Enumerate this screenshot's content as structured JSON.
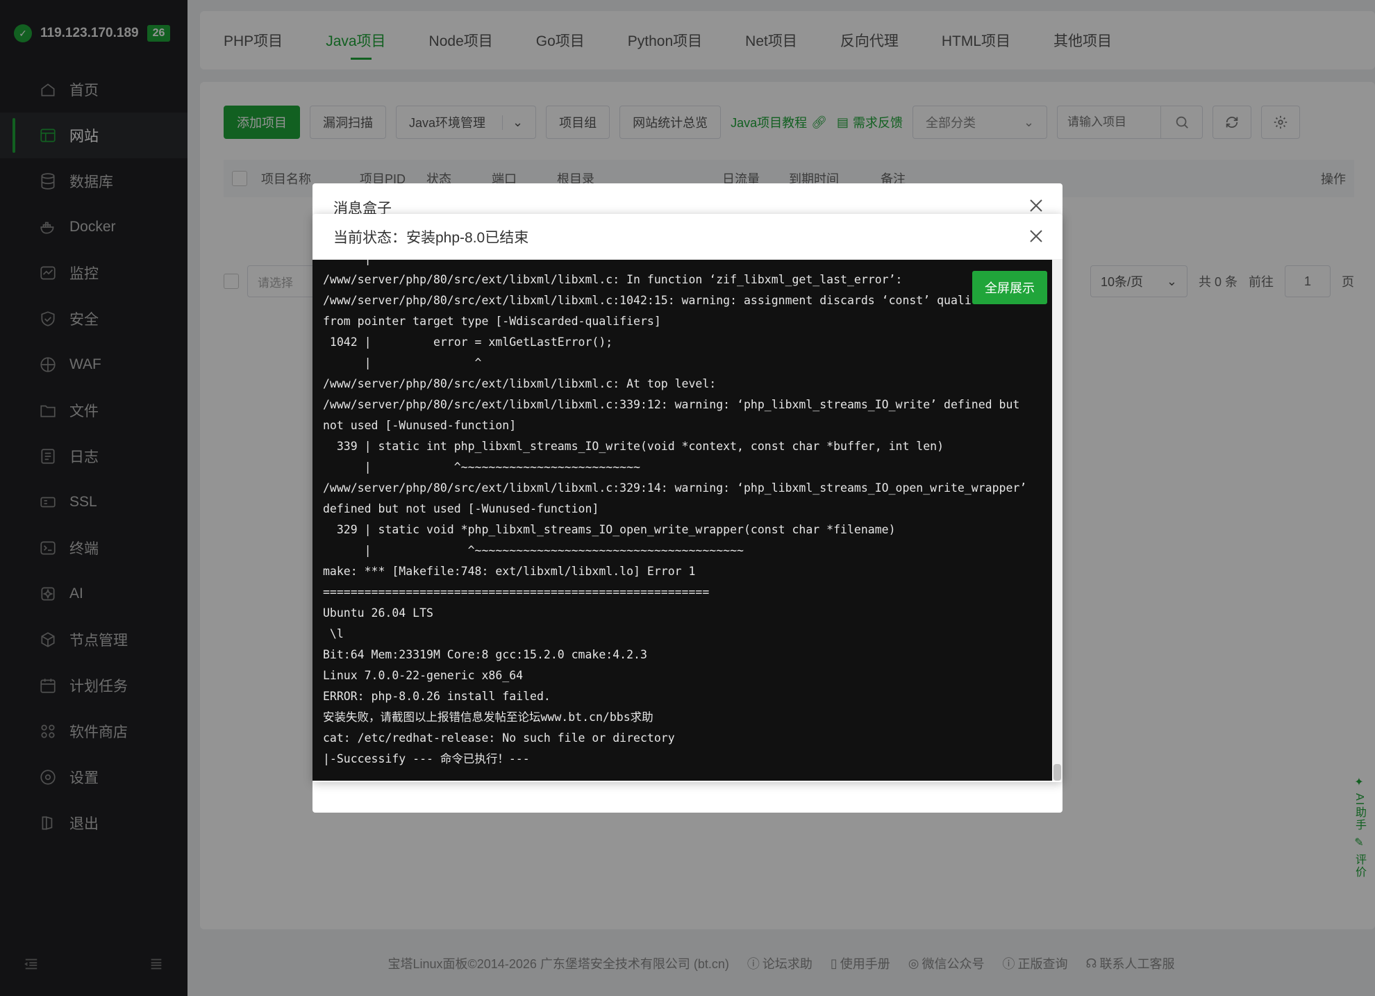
{
  "server": {
    "ip": "119.123.170.189",
    "badge": "26"
  },
  "sidebar": {
    "items": [
      {
        "label": "首页",
        "icon": "home-icon"
      },
      {
        "label": "网站",
        "icon": "website-icon",
        "active": true
      },
      {
        "label": "数据库",
        "icon": "database-icon"
      },
      {
        "label": "Docker",
        "icon": "docker-icon"
      },
      {
        "label": "监控",
        "icon": "monitor-icon"
      },
      {
        "label": "安全",
        "icon": "shield-icon"
      },
      {
        "label": "WAF",
        "icon": "waf-icon"
      },
      {
        "label": "文件",
        "icon": "folder-icon"
      },
      {
        "label": "日志",
        "icon": "log-icon"
      },
      {
        "label": "SSL",
        "icon": "ssl-icon"
      },
      {
        "label": "终端",
        "icon": "terminal-icon"
      },
      {
        "label": "AI",
        "icon": "ai-icon"
      },
      {
        "label": "节点管理",
        "icon": "node-icon"
      },
      {
        "label": "计划任务",
        "icon": "calendar-icon"
      },
      {
        "label": "软件商店",
        "icon": "store-icon"
      },
      {
        "label": "设置",
        "icon": "settings-icon"
      },
      {
        "label": "退出",
        "icon": "logout-icon"
      }
    ]
  },
  "tabs": [
    "PHP项目",
    "Java项目",
    "Node项目",
    "Go项目",
    "Python项目",
    "Net项目",
    "反向代理",
    "HTML项目",
    "其他项目"
  ],
  "active_tab": "Java项目",
  "toolbar": {
    "add": "添加项目",
    "scan": "漏洞扫描",
    "java_env": "Java环境管理",
    "group": "项目组",
    "stats": "网站统计总览",
    "tutorial": "Java项目教程",
    "feedback": "需求反馈",
    "category": "全部分类",
    "search_placeholder": "请输入项目"
  },
  "table": {
    "columns": [
      "项目名称",
      "项目PID",
      "状态",
      "端口",
      "根目录",
      "日流量",
      "到期时间",
      "备注",
      "操作"
    ]
  },
  "pager": {
    "select_placeholder": "请选择",
    "page_size": "10条/页",
    "total": "共 0 条",
    "goto": "前往",
    "page": "1",
    "page_unit": "页"
  },
  "dialog_back": {
    "title": "消息盒子"
  },
  "dialog": {
    "title": "当前状态：安装php-8.0已结束",
    "fullscreen": "全屏展示",
    "log_lines": [
      "      |                   ^~~~~~~~~~~~~~~~~~~~~~~~~~~~~~~~",
      "/www/server/php/80/src/ext/libxml/libxml.c: In function ‘zif_libxml_get_last_error’:",
      "/www/server/php/80/src/ext/libxml/libxml.c:1042:15: warning: assignment discards ‘const’ qualifier",
      "from pointer target type [-Wdiscarded-qualifiers]",
      " 1042 |         error = xmlGetLastError();",
      "      |               ^",
      "/www/server/php/80/src/ext/libxml/libxml.c: At top level:",
      "/www/server/php/80/src/ext/libxml/libxml.c:339:12: warning: ‘php_libxml_streams_IO_write’ defined but",
      "not used [-Wunused-function]",
      "  339 | static int php_libxml_streams_IO_write(void *context, const char *buffer, int len)",
      "      |            ^~~~~~~~~~~~~~~~~~~~~~~~~~~",
      "/www/server/php/80/src/ext/libxml/libxml.c:329:14: warning: ‘php_libxml_streams_IO_open_write_wrapper’",
      "defined but not used [-Wunused-function]",
      "  329 | static void *php_libxml_streams_IO_open_write_wrapper(const char *filename)",
      "      |              ^~~~~~~~~~~~~~~~~~~~~~~~~~~~~~~~~~~~~~~~",
      "make: *** [Makefile:748: ext/libxml/libxml.lo] Error 1",
      "========================================================",
      "Ubuntu 26.04 LTS",
      " \\l",
      "Bit:64 Mem:23319M Core:8 gcc:15.2.0 cmake:4.2.3",
      "Linux 7.0.0-22-generic x86_64",
      "ERROR: php-8.0.26 install failed.",
      "安装失败，请截图以上报错信息发帖至论坛www.bt.cn/bbs求助",
      "cat: /etc/redhat-release: No such file or directory",
      "|-Successify --- 命令已执行！---"
    ]
  },
  "footer": {
    "copyright": "宝塔Linux面板©2014-2026 广东堡塔安全技术有限公司 (bt.cn)",
    "links": [
      "论坛求助",
      "使用手册",
      "微信公众号",
      "正版查询",
      "联系人工客服"
    ]
  },
  "float": {
    "ai": "AI助手",
    "review": "评价"
  },
  "colors": {
    "accent": "#20a53a",
    "sidebar_bg": "#1f2023",
    "terminal_bg": "#111111"
  }
}
